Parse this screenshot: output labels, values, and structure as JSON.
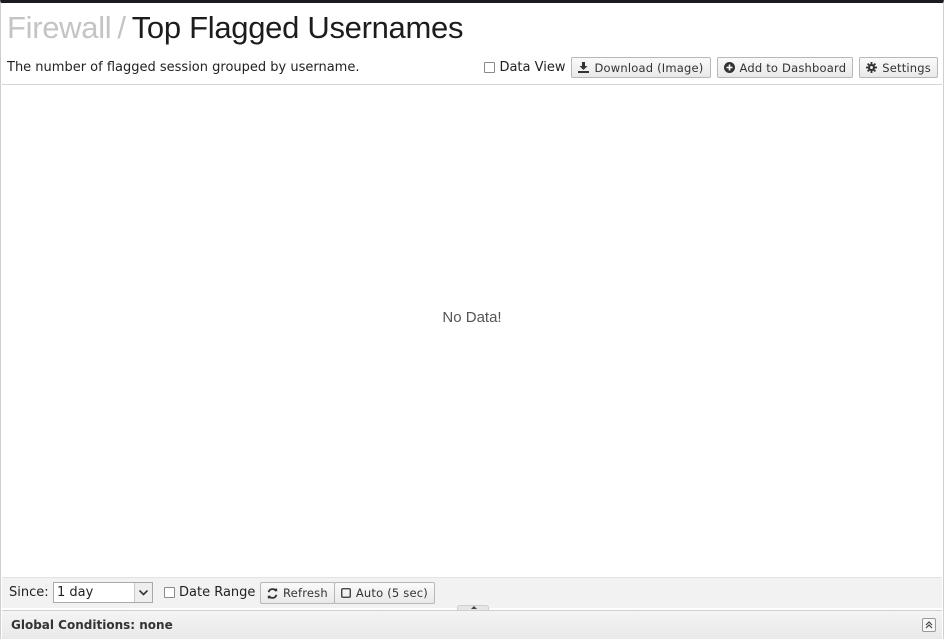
{
  "header": {
    "breadcrumb_parent": "Firewall",
    "breadcrumb_separator": "/",
    "title": "Top Flagged Usernames"
  },
  "description": "The number of flagged session grouped by username.",
  "toolbar": {
    "data_view_label": "Data View",
    "data_view_checked": false,
    "download_label": "Download (Image)",
    "add_dashboard_label": "Add to Dashboard",
    "settings_label": "Settings"
  },
  "chart": {
    "empty_message": "No Data!"
  },
  "footer": {
    "since_label": "Since:",
    "since_value": "1 day",
    "date_range_label": "Date Range",
    "date_range_checked": false,
    "refresh_label": "Refresh",
    "auto_label": "Auto (5 sec)"
  },
  "global_conditions": {
    "text": "Global Conditions: none"
  },
  "icons": {
    "download": "download-icon",
    "add": "plus-circle-icon",
    "settings": "gear-icon",
    "refresh": "refresh-icon",
    "auto": "square-icon",
    "expand": "double-chevron-up-icon"
  },
  "colors": {
    "breadcrumb_parent": "#c4c4c4",
    "title": "#1c1c1c",
    "top_border": "#1a1a22"
  }
}
